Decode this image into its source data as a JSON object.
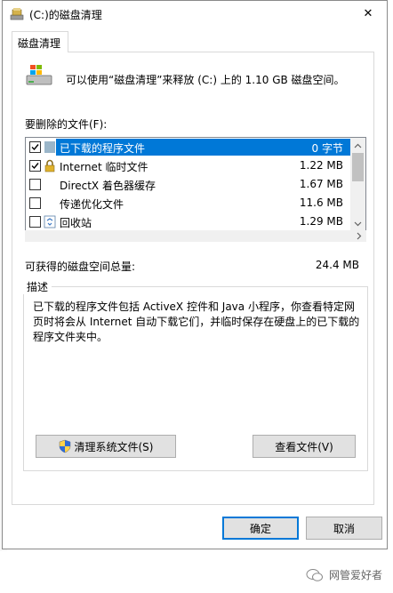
{
  "window": {
    "title": "(C:)的磁盘清理",
    "close_glyph": "✕"
  },
  "tab": {
    "label": "磁盘清理"
  },
  "summary": {
    "text": "可以使用“磁盘清理”来释放  (C:) 上的 1.10 GB 磁盘空间。"
  },
  "files": {
    "label": "要删除的文件(F):",
    "items": [
      {
        "name": "已下载的程序文件",
        "size": "0 字节",
        "checked": true,
        "icon": "folder-icon",
        "selected": true
      },
      {
        "name": "Internet 临时文件",
        "size": "1.22 MB",
        "checked": true,
        "icon": "lock-icon",
        "selected": false
      },
      {
        "name": "DirectX 着色器缓存",
        "size": "1.67 MB",
        "checked": false,
        "icon": "blank-file-icon",
        "selected": false
      },
      {
        "name": "传递优化文件",
        "size": "11.6 MB",
        "checked": false,
        "icon": "blank-file-icon",
        "selected": false
      },
      {
        "name": "回收站",
        "size": "1.29 MB",
        "checked": false,
        "icon": "recycle-bin-icon",
        "selected": false
      }
    ]
  },
  "total": {
    "label": "可获得的磁盘空间总量:",
    "value": "24.4 MB"
  },
  "description": {
    "title": "描述",
    "text": "已下载的程序文件包括 ActiveX 控件和 Java 小程序，你查看特定网页时将会从 Internet 自动下载它们，并临时保存在硬盘上的已下载的程序文件夹中。"
  },
  "buttons": {
    "clean_system": "清理系统文件(S)",
    "view_files": "查看文件(V)",
    "ok": "确定",
    "cancel": "取消"
  },
  "watermark": {
    "text": "网管爱好者"
  },
  "colors": {
    "accent": "#0078d7"
  }
}
